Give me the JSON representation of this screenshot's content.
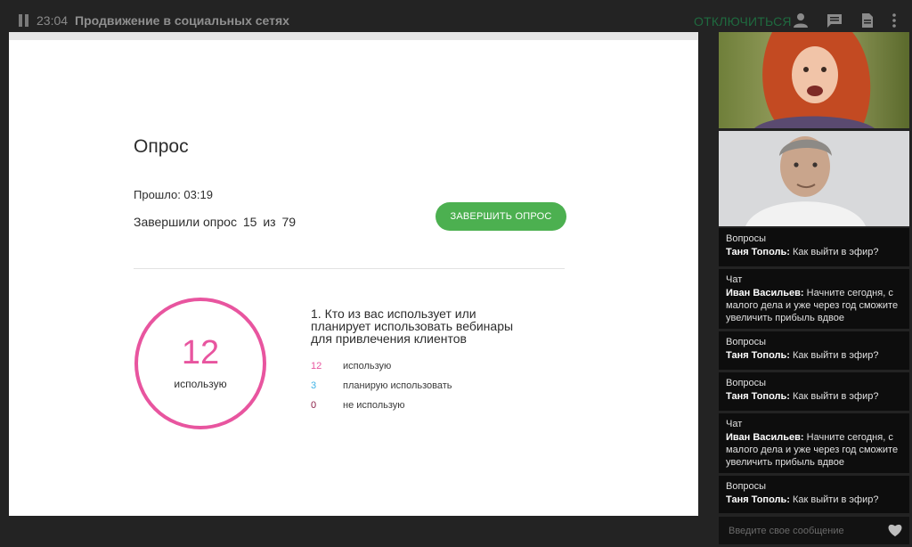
{
  "header": {
    "time": "23:04",
    "title": "Продвижение в социальных сетях",
    "disconnect_label": "ОТКЛЮЧИТЬСЯ",
    "icons": [
      "pause-icon",
      "user-icon",
      "chat-icon",
      "document-icon",
      "more-vertical-icon"
    ]
  },
  "poll": {
    "title": "Опрос",
    "elapsed": "Прошло: 03:19",
    "completed_prefix": "Завершили опрос",
    "completed_count": "15",
    "completed_of": "из",
    "completed_total": "79",
    "finish_label": "ЗАВЕРШИТЬ ОПРОС",
    "highlight_value": "12",
    "highlight_label": "использую",
    "question": "1. Кто из вас использует или планирует использовать вебинары для привлечения клиентов",
    "answers": [
      {
        "count": "12",
        "label": "использую",
        "color": "#e8559f"
      },
      {
        "count": "3",
        "label": "планирую использовать",
        "color": "#3fb3e6"
      },
      {
        "count": "0",
        "label": "не использую",
        "color": "#8c2048"
      }
    ]
  },
  "feed": {
    "messages": [
      {
        "kind": "Вопросы",
        "author": "Таня Тополь:",
        "text": "Как выйти в эфир?"
      },
      {
        "kind": "Чат",
        "author": "Иван Васильев:",
        "text": "Начните сегодня, с малого дела и уже через год сможите увеличить прибыль вдвое"
      },
      {
        "kind": "Вопросы",
        "author": "Таня Тополь:",
        "text": "Как выйти в эфир?"
      },
      {
        "kind": "Вопросы",
        "author": "Таня Тополь:",
        "text": "Как выйти в эфир?"
      },
      {
        "kind": "Чат",
        "author": "Иван Васильев:",
        "text": "Начните сегодня, с малого дела и уже через год сможите увеличить прибыль вдвое"
      },
      {
        "kind": "Вопросы",
        "author": "Таня Тополь:",
        "text": "Как выйти в эфир?"
      }
    ]
  },
  "composer": {
    "placeholder": "Введите свое сообщение",
    "icon": "heart-icon"
  },
  "colors": {
    "accent_green": "#4cb050",
    "ring_pink": "#e8559f",
    "disconnect_green": "#1f6a3f"
  }
}
